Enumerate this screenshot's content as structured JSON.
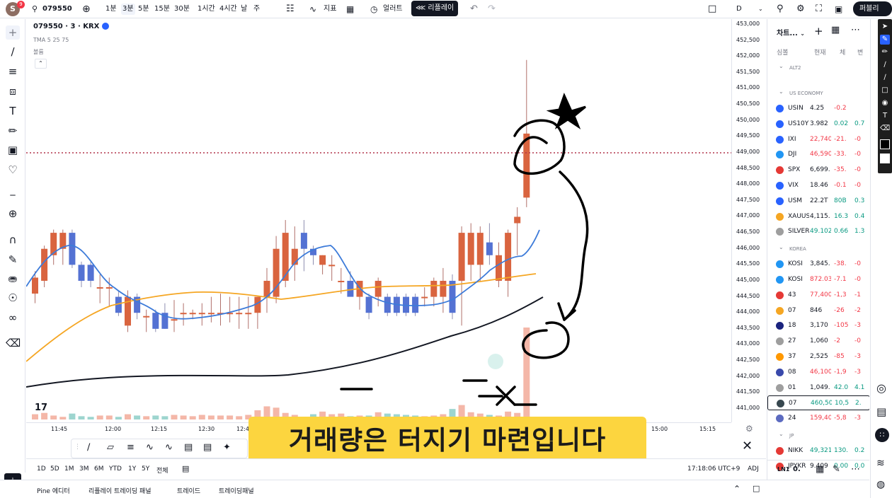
{
  "topbar": {
    "avatar_letter": "S",
    "avatar_badge": "9",
    "symbol": "079550",
    "intervals": [
      "1분",
      "3분",
      "5분",
      "15분",
      "30분",
      "1시간",
      "4시간",
      "날",
      "주"
    ],
    "selected_interval": "3분",
    "indicators_label": "지표",
    "alert_label": "얼러트",
    "replay_label": "리플레이",
    "layout_label": "D",
    "publish_label": "퍼블리"
  },
  "legend": {
    "title": "079550 · 3 · KRX",
    "ma_label": "TMA 5 25 75",
    "volume_label": "볼륨"
  },
  "chart_data": {
    "type": "candlestick",
    "price_axis": [
      "453,000",
      "452,500",
      "452,000",
      "451,500",
      "451,000",
      "450,500",
      "450,000",
      "449,500",
      "449,000",
      "448,500",
      "448,000",
      "447,500",
      "447,000",
      "446,500",
      "446,000",
      "445,500",
      "445,000",
      "444,500",
      "444,000",
      "443,500",
      "443,000",
      "442,500",
      "442,000",
      "441,500",
      "441,000"
    ],
    "time_axis": [
      "11:45",
      "12:00",
      "12:15",
      "12:30",
      "12:4",
      "15:00",
      "15:15"
    ],
    "ylim": [
      440800,
      453000
    ],
    "candles": [
      {
        "o": 444600,
        "h": 445300,
        "l": 444300,
        "c": 445100
      },
      {
        "o": 445000,
        "h": 446100,
        "l": 444800,
        "c": 446000
      },
      {
        "o": 445800,
        "h": 446600,
        "l": 445500,
        "c": 446500
      },
      {
        "o": 446000,
        "h": 446600,
        "l": 445500,
        "c": 446500
      },
      {
        "o": 446500,
        "h": 446600,
        "l": 445400,
        "c": 445500
      },
      {
        "o": 445500,
        "h": 445600,
        "l": 444800,
        "c": 445000
      },
      {
        "o": 445500,
        "h": 445600,
        "l": 444800,
        "c": 445000
      },
      {
        "o": 444800,
        "h": 445200,
        "l": 444300,
        "c": 444800
      },
      {
        "o": 444800,
        "h": 445100,
        "l": 444200,
        "c": 444800
      },
      {
        "o": 444500,
        "h": 444700,
        "l": 443900,
        "c": 444000
      },
      {
        "o": 443600,
        "h": 444700,
        "l": 443400,
        "c": 444500
      },
      {
        "o": 444500,
        "h": 444600,
        "l": 443800,
        "c": 444000
      },
      {
        "o": 443900,
        "h": 444100,
        "l": 443400,
        "c": 443900
      },
      {
        "o": 444000,
        "h": 444100,
        "l": 443400,
        "c": 443500
      },
      {
        "o": 444000,
        "h": 444300,
        "l": 443500,
        "c": 443500
      },
      {
        "o": 443800,
        "h": 444400,
        "l": 443400,
        "c": 443800
      },
      {
        "o": 444000,
        "h": 444300,
        "l": 443600,
        "c": 444000
      },
      {
        "o": 444000,
        "h": 444100,
        "l": 443800,
        "c": 444000
      },
      {
        "o": 444000,
        "h": 444300,
        "l": 443600,
        "c": 444000
      },
      {
        "o": 444000,
        "h": 444500,
        "l": 443700,
        "c": 444000
      },
      {
        "o": 444000,
        "h": 444600,
        "l": 443600,
        "c": 444000
      },
      {
        "o": 444000,
        "h": 444500,
        "l": 443700,
        "c": 444000
      },
      {
        "o": 444000,
        "h": 444500,
        "l": 443500,
        "c": 444000
      },
      {
        "o": 444000,
        "h": 444500,
        "l": 443500,
        "c": 444000
      },
      {
        "o": 444000,
        "h": 444500,
        "l": 443500,
        "c": 444500
      },
      {
        "o": 444500,
        "h": 445400,
        "l": 444000,
        "c": 445000
      },
      {
        "o": 444500,
        "h": 446400,
        "l": 444300,
        "c": 446000
      },
      {
        "o": 445000,
        "h": 446900,
        "l": 444800,
        "c": 446500
      },
      {
        "o": 445500,
        "h": 446700,
        "l": 445000,
        "c": 446000
      },
      {
        "o": 446500,
        "h": 446900,
        "l": 445300,
        "c": 446000
      },
      {
        "o": 446000,
        "h": 446100,
        "l": 445500,
        "c": 445800
      },
      {
        "o": 445500,
        "h": 445800,
        "l": 445200,
        "c": 445800
      },
      {
        "o": 445500,
        "h": 445800,
        "l": 445000,
        "c": 445500
      },
      {
        "o": 445000,
        "h": 445400,
        "l": 444600,
        "c": 445000
      },
      {
        "o": 445000,
        "h": 445300,
        "l": 444600,
        "c": 444500
      },
      {
        "o": 444500,
        "h": 445000,
        "l": 444100,
        "c": 445000
      },
      {
        "o": 444500,
        "h": 444600,
        "l": 443800,
        "c": 444000
      },
      {
        "o": 444500,
        "h": 445100,
        "l": 444200,
        "c": 445000
      },
      {
        "o": 444500,
        "h": 444600,
        "l": 443900,
        "c": 444000
      },
      {
        "o": 444500,
        "h": 444600,
        "l": 443900,
        "c": 444000
      },
      {
        "o": 444500,
        "h": 444600,
        "l": 443900,
        "c": 444000
      },
      {
        "o": 444500,
        "h": 444600,
        "l": 443900,
        "c": 444000
      },
      {
        "o": 444500,
        "h": 444800,
        "l": 444200,
        "c": 444500
      },
      {
        "o": 444500,
        "h": 445100,
        "l": 444200,
        "c": 445000
      },
      {
        "o": 444500,
        "h": 445400,
        "l": 444000,
        "c": 445000
      },
      {
        "o": 445000,
        "h": 445200,
        "l": 443800,
        "c": 444000
      },
      {
        "o": 445000,
        "h": 446700,
        "l": 443600,
        "c": 446500
      },
      {
        "o": 445500,
        "h": 446800,
        "l": 445000,
        "c": 446500
      },
      {
        "o": 445500,
        "h": 446700,
        "l": 445000,
        "c": 446500
      },
      {
        "o": 446200,
        "h": 446800,
        "l": 445500,
        "c": 445800
      },
      {
        "o": 445000,
        "h": 446200,
        "l": 444800,
        "c": 445800
      },
      {
        "o": 445000,
        "h": 446600,
        "l": 444500,
        "c": 446500
      },
      {
        "o": 446800,
        "h": 447300,
        "l": 445800,
        "c": 447000
      },
      {
        "o": 447600,
        "h": 451900,
        "l": 447300,
        "c": 449600
      }
    ],
    "volumes": [
      8,
      10,
      6,
      4,
      9,
      5,
      4,
      6,
      6,
      4,
      8,
      6,
      5,
      6,
      5,
      7,
      6,
      5,
      7,
      6,
      6,
      6,
      5,
      7,
      14,
      20,
      18,
      10,
      7,
      4,
      8,
      12,
      8,
      9,
      5,
      6,
      6,
      11,
      9,
      8,
      7,
      6,
      5,
      6,
      8,
      16,
      22,
      11,
      9,
      7,
      6,
      12,
      10,
      140
    ],
    "current_price_line": 449000
  },
  "watchlist": {
    "title": "차트...",
    "columns": [
      "심볼",
      "현재",
      "체",
      "변"
    ],
    "sections": [
      {
        "name": "ALT2",
        "rows": []
      },
      {
        "name": "US ECONOMY",
        "rows": [
          {
            "sym": "USIN",
            "last": "4.25",
            "chg": "-0.2",
            "pct": "",
            "color": "#2962ff",
            "up": false
          },
          {
            "sym": "US10Y",
            "last": "3.982",
            "chg": "0.02",
            "pct": "0.7",
            "color": "#2962ff",
            "up": true
          },
          {
            "sym": "IXI",
            "last": "22,740",
            "chg": "-21.",
            "pct": "-0",
            "color": "#2962ff",
            "up": false
          },
          {
            "sym": "DJI",
            "last": "46,590",
            "chg": "-33.",
            "pct": "-0",
            "color": "#2196f3",
            "up": false
          },
          {
            "sym": "SPX",
            "last": "6,699.",
            "chg": "-35.",
            "pct": "-0",
            "color": "#e53935",
            "up": false
          },
          {
            "sym": "VIX",
            "last": "18.46",
            "chg": "-0.1",
            "pct": "-0",
            "color": "#2962ff",
            "up": false
          },
          {
            "sym": "USM",
            "last": "22.2T",
            "chg": "80B",
            "pct": "0.3",
            "color": "#2962ff",
            "up": true
          },
          {
            "sym": "XAUUS",
            "last": "4,115.",
            "chg": "16.3",
            "pct": "0.4",
            "color": "#f5a623",
            "up": true
          },
          {
            "sym": "SILVER",
            "last": "49.102",
            "chg": "0.66",
            "pct": "1.3",
            "color": "#9e9e9e",
            "up": true
          }
        ]
      },
      {
        "name": "KOREA",
        "rows": [
          {
            "sym": "KOSI",
            "last": "3,845.",
            "chg": "-38.",
            "pct": "-0",
            "color": "#2196f3",
            "up": false
          },
          {
            "sym": "KOSI",
            "last": "872.03",
            "chg": "-7.1",
            "pct": "-0",
            "color": "#2196f3",
            "up": false
          },
          {
            "sym": "43",
            "last": "77,400",
            "chg": "-1,3",
            "pct": "-1",
            "color": "#e53935",
            "up": false
          },
          {
            "sym": "07",
            "last": "846",
            "chg": "-26",
            "pct": "-2",
            "color": "#f5a623",
            "up": false
          },
          {
            "sym": "18",
            "last": "3,170",
            "chg": "-105",
            "pct": "-3",
            "color": "#1a237e",
            "up": false
          },
          {
            "sym": "27",
            "last": "1,060",
            "chg": "-2",
            "pct": "-0",
            "color": "#9e9e9e",
            "up": false
          },
          {
            "sym": "37",
            "last": "2,525",
            "chg": "-85",
            "pct": "-3",
            "color": "#ff9800",
            "up": false
          },
          {
            "sym": "08",
            "last": "46,100",
            "chg": "-1,9",
            "pct": "-3",
            "color": "#3949ab",
            "up": false
          },
          {
            "sym": "01",
            "last": "1,049.",
            "chg": "42.0",
            "pct": "4.1",
            "color": "#9e9e9e",
            "up": true
          },
          {
            "sym": "07",
            "last": "460,50",
            "chg": "10,5",
            "pct": "2.",
            "color": "#37474f",
            "up": true
          },
          {
            "sym": "24",
            "last": "159,40",
            "chg": "-5,8",
            "pct": "-3",
            "color": "#5c6bc0",
            "up": false
          }
        ]
      },
      {
        "name": "JP",
        "rows": [
          {
            "sym": "NIKK",
            "last": "49,321",
            "chg": "130.",
            "pct": "0.2",
            "color": "#e53935",
            "up": true
          },
          {
            "sym": "JPYKR",
            "last": "9.409",
            "chg": "0.00",
            "pct": "0.0",
            "color": "#e53935",
            "up": true
          }
        ]
      }
    ],
    "footer_label": "0."
  },
  "range_bar": {
    "ranges": [
      "1D",
      "5D",
      "1M",
      "3M",
      "6M",
      "YTD",
      "1Y",
      "5Y",
      "전체"
    ],
    "clock": "17:18:06 UTC+9",
    "adj": "ADJ"
  },
  "bottom_tabs": [
    "Pine 에디터",
    "리플레이 트레이딩 패널",
    "트레이드",
    "트레이딩패널"
  ],
  "subtitle": "거래량은 터지기 마련입니다",
  "tv_logo": "17"
}
